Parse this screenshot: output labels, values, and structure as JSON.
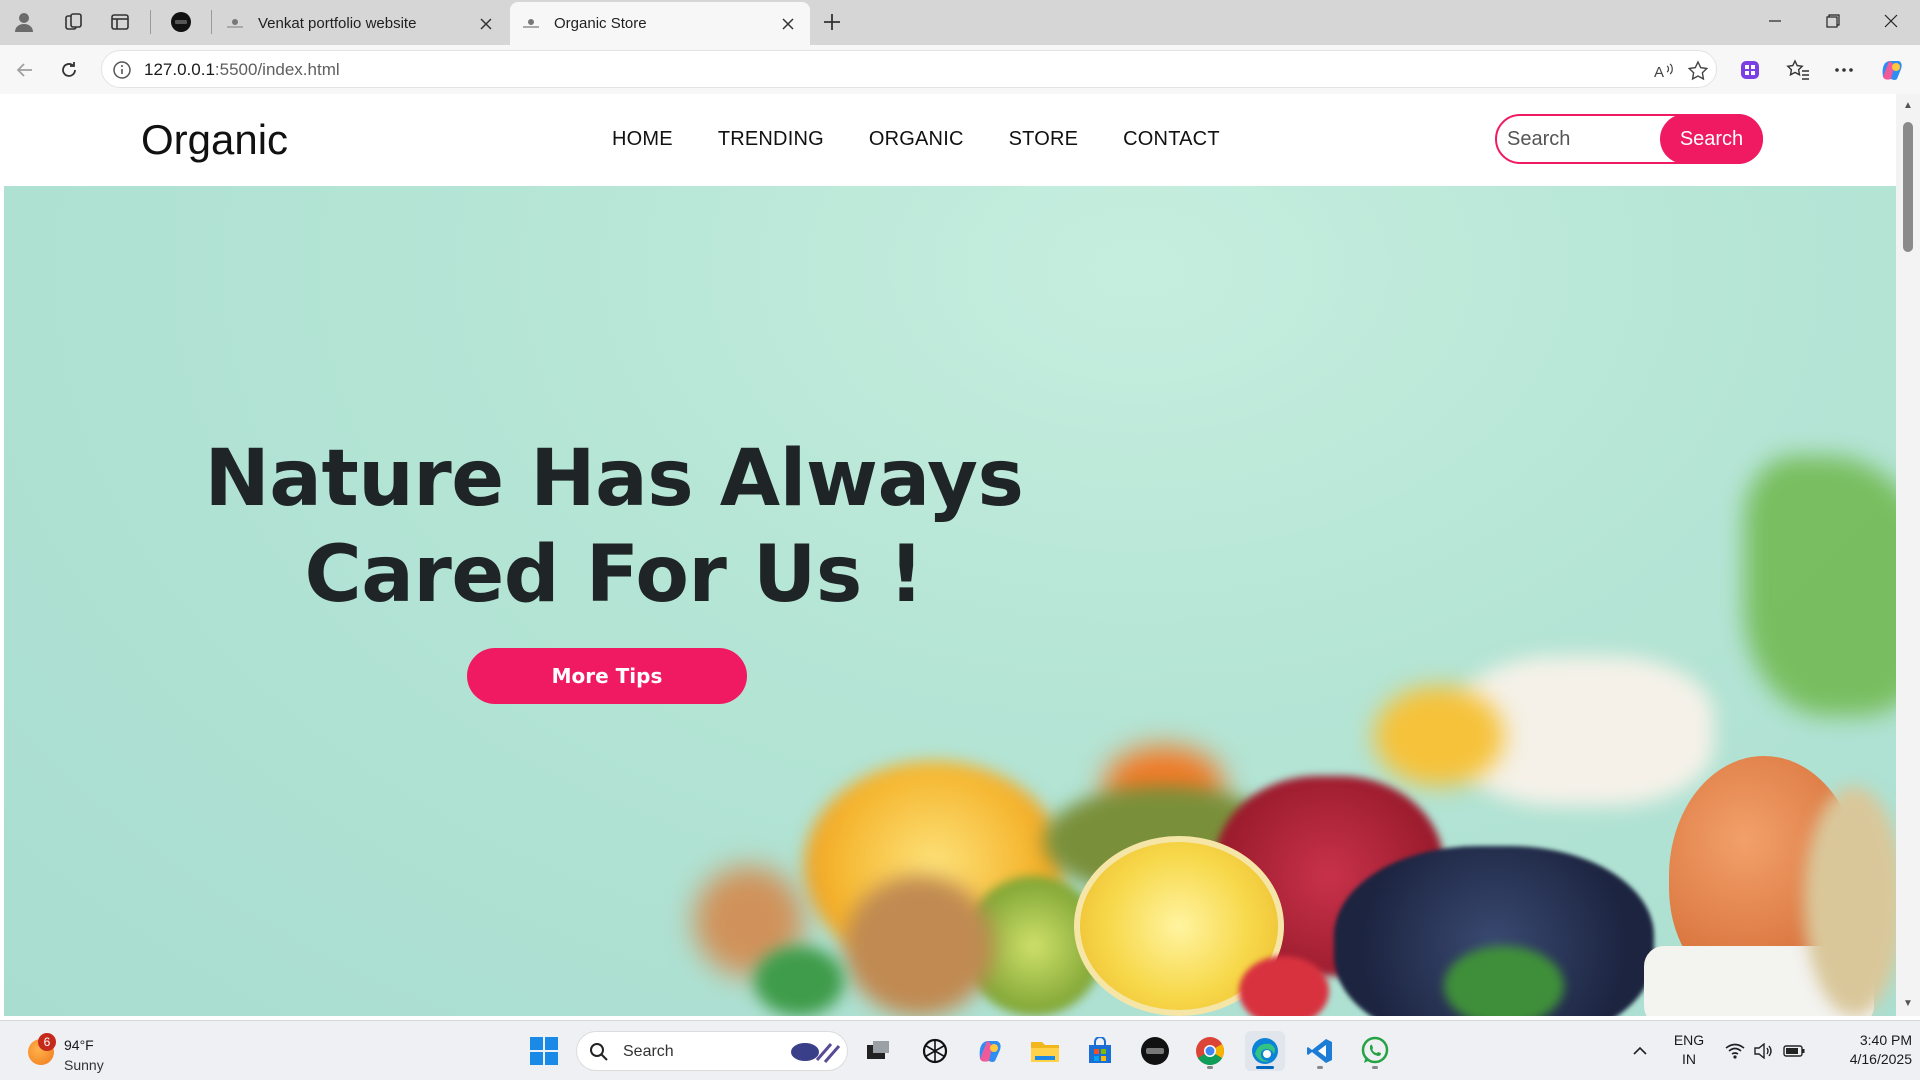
{
  "browser": {
    "tabs": [
      {
        "title": "Venkat portfolio website",
        "active": false
      },
      {
        "title": "Organic Store",
        "active": true
      }
    ],
    "new_tab_label": "+",
    "url_host": "127.0.0.1",
    "url_path": ":5500/index.html"
  },
  "site": {
    "logo": "Organic",
    "nav": [
      "HOME",
      "TRENDING",
      "ORGANIC",
      "STORE",
      "CONTACT"
    ],
    "search_placeholder": "Search",
    "search_button": "Search",
    "hero_line1": "Nature Has Always",
    "hero_line2": "Cared For Us !",
    "cta_label": "More Tips",
    "colors": {
      "accent": "#f01a63",
      "hero_bg": "#b5e5d5",
      "headline": "#1f2526"
    }
  },
  "taskbar": {
    "weather_badge": "6",
    "weather_temp": "94°F",
    "weather_cond": "Sunny",
    "search_label": "Search",
    "apps": [
      "start-icon",
      "task-view-icon",
      "chatgpt-icon",
      "copilot-icon",
      "file-explorer-icon",
      "microsoft-store-icon",
      "app-icon",
      "chrome-icon",
      "edge-icon",
      "vscode-icon",
      "whatsapp-icon"
    ],
    "lang_line1": "ENG",
    "lang_line2": "IN",
    "time": "3:40 PM",
    "date": "4/16/2025"
  }
}
